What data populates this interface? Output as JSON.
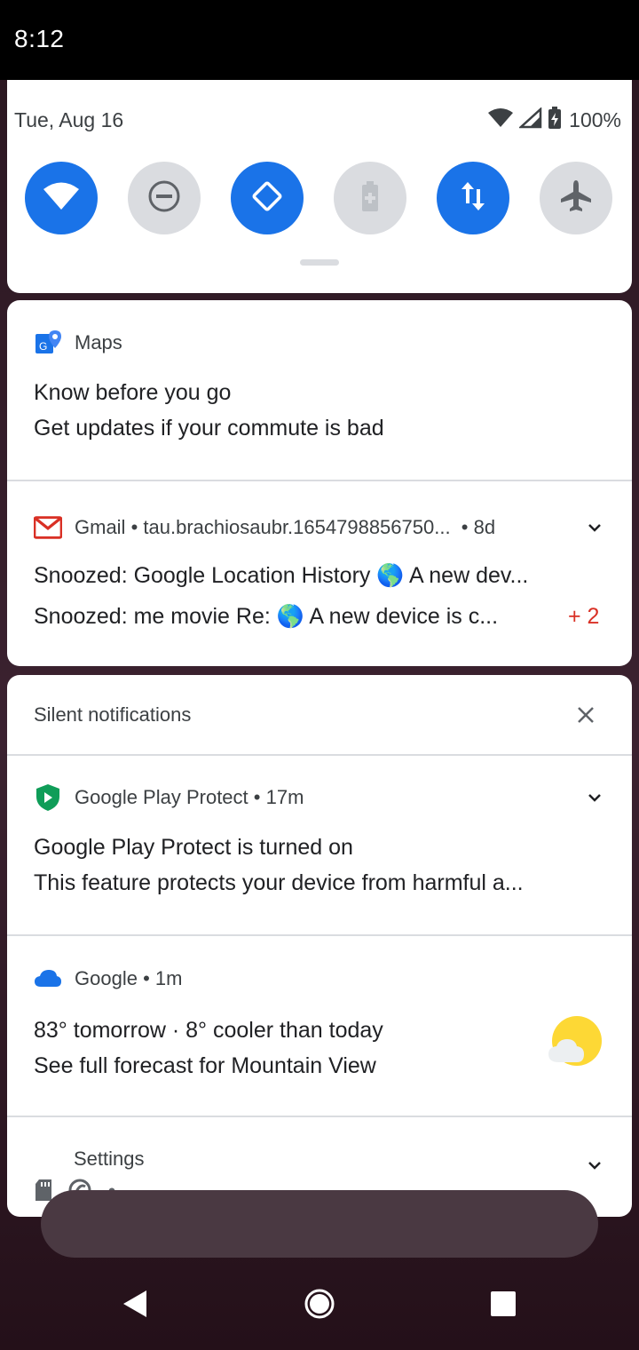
{
  "status_bar": {
    "time": "8:12"
  },
  "quick_settings": {
    "date": "Tue, Aug 16",
    "battery_percent": "100%",
    "tiles": [
      {
        "name": "wifi",
        "active": true
      },
      {
        "name": "do-not-disturb",
        "active": false
      },
      {
        "name": "auto-rotate",
        "active": true
      },
      {
        "name": "battery-saver",
        "active": false
      },
      {
        "name": "mobile-data",
        "active": true
      },
      {
        "name": "airplane-mode",
        "active": false
      }
    ]
  },
  "notifications": {
    "maps": {
      "app": "Maps",
      "title": "Know before you go",
      "text": "Get updates if your commute is bad"
    },
    "gmail": {
      "app": "Gmail",
      "account": "tau.brachiosaubr.1654798856750...",
      "age": "8d",
      "line1": "Snoozed: Google Location History 🌎 A new dev...",
      "line2": "Snoozed: me movie Re: 🌎 A new device is c...",
      "more_count": "+ 2"
    },
    "silent_header": "Silent notifications",
    "play_protect": {
      "app": "Google Play Protect",
      "age": "17m",
      "title": "Google Play Protect is turned on",
      "text": "This feature protects your device from harmful a..."
    },
    "google": {
      "app": "Google",
      "age": "1m",
      "title": "83° tomorrow · 8° cooler than today",
      "text": "See full forecast for Mountain View"
    },
    "settings": {
      "app": "Settings"
    }
  },
  "colors": {
    "accent": "#1a73e8",
    "gmail_red": "#d93025",
    "play_green": "#0f9d58",
    "weather_sun": "#fdd835"
  }
}
